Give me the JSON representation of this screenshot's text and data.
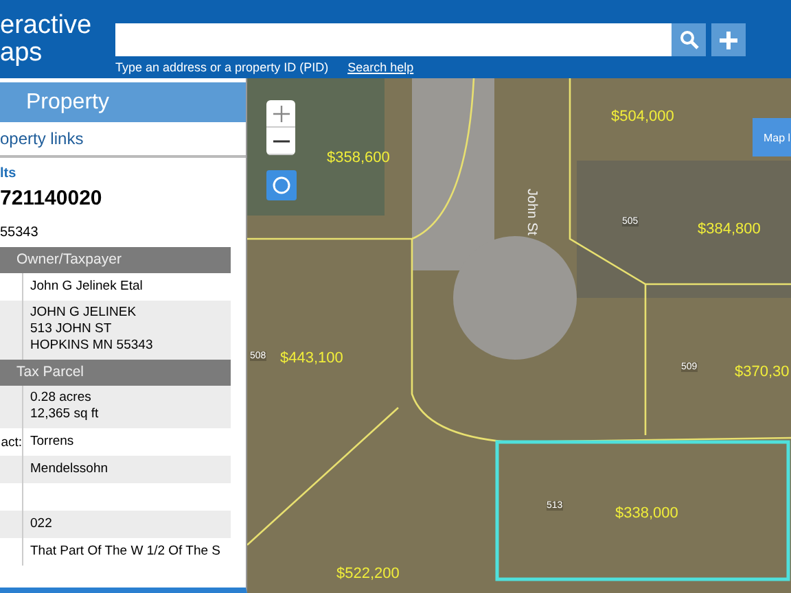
{
  "header": {
    "title_lines": [
      "eractive",
      "aps"
    ],
    "search": {
      "hint": "Type an address or a property ID (PID)",
      "help_link": "Search help"
    }
  },
  "sidebar": {
    "title": "Property",
    "links": "operty links",
    "section": "lts",
    "pid": "721140020",
    "zip": "55343",
    "table": [
      {
        "kind": "header",
        "text": "Owner/Taxpayer"
      },
      {
        "kind": "row",
        "lines": [
          "John G Jelinek Etal"
        ]
      },
      {
        "kind": "row",
        "lines": [
          "JOHN G JELINEK",
          "513 JOHN ST",
          "HOPKINS MN 55343"
        ]
      },
      {
        "kind": "header",
        "text": "Tax Parcel"
      },
      {
        "kind": "row",
        "lines": [
          "0.28 acres",
          "12,365 sq ft"
        ]
      },
      {
        "kind": "row",
        "label": "act:",
        "lines": [
          "Torrens"
        ]
      },
      {
        "kind": "row",
        "lines": [
          "Mendelssohn"
        ]
      },
      {
        "kind": "row"
      },
      {
        "kind": "row",
        "lines": [
          "022"
        ]
      },
      {
        "kind": "row",
        "lines": [
          "That Part Of The W 1/2 Of The S"
        ]
      }
    ]
  },
  "map": {
    "street": "John St",
    "map_button": "Map l",
    "prices": [
      "$358,600",
      "$504,000",
      "$384,800",
      "$443,100",
      "$370,30",
      "$338,000",
      "$522,200"
    ],
    "house_numbers": [
      "505",
      "508",
      "509",
      "513"
    ]
  }
}
